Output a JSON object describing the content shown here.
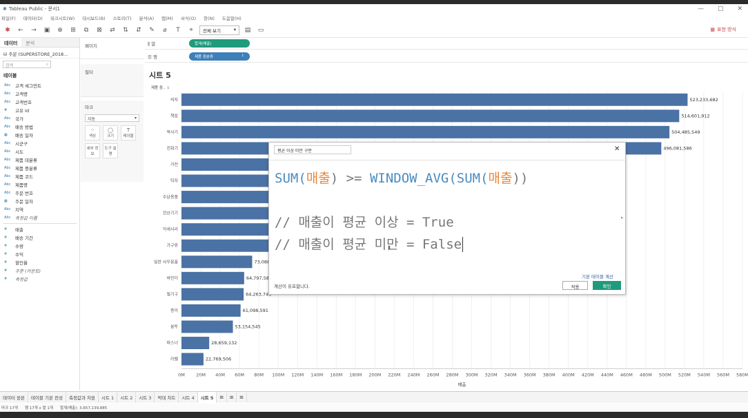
{
  "window": {
    "title": "Tableau Public - 문서1",
    "controls": [
      "—",
      "▢",
      "✕"
    ]
  },
  "menu": [
    "파일(F)",
    "데이터(D)",
    "워크시트(W)",
    "대시보드(B)",
    "스토리(T)",
    "분석(A)",
    "맵(M)",
    "서식(O)",
    "창(N)",
    "도움말(H)"
  ],
  "toolbar": {
    "view_select": "전체 보기",
    "showme": "표현 방식"
  },
  "datapane": {
    "tab_data": "데이터",
    "tab_analysis": "분석",
    "source": "주문 (SUPERSTORE_2018...",
    "search_placeholder": "검색",
    "tables_header": "테이블",
    "dimensions": [
      {
        "type": "Abc",
        "name": "고객 세그먼트"
      },
      {
        "type": "Abc",
        "name": "고객명"
      },
      {
        "type": "Abc",
        "name": "고객번호"
      },
      {
        "type": "#",
        "name": "고유 Id"
      },
      {
        "type": "Abc",
        "name": "국가"
      },
      {
        "type": "Abc",
        "name": "배송 방법"
      },
      {
        "type": "▦",
        "name": "배송 일자"
      },
      {
        "type": "Abc",
        "name": "시군구"
      },
      {
        "type": "Abc",
        "name": "시도"
      },
      {
        "type": "Abc",
        "name": "제품 대분류"
      },
      {
        "type": "Abc",
        "name": "제품 중분류"
      },
      {
        "type": "Abc",
        "name": "제품 코드"
      },
      {
        "type": "Abc",
        "name": "제품명"
      },
      {
        "type": "Abc",
        "name": "주문 번호"
      },
      {
        "type": "▦",
        "name": "주문 일자"
      },
      {
        "type": "Abc",
        "name": "지역"
      },
      {
        "type": "Abc",
        "name": "측정값 이름"
      }
    ],
    "measures": [
      {
        "type": "#",
        "name": "매출"
      },
      {
        "type": "#",
        "name": "배송 기간"
      },
      {
        "type": "#",
        "name": "수량"
      },
      {
        "type": "#",
        "name": "수익"
      },
      {
        "type": "#",
        "name": "할인율"
      },
      {
        "type": "#",
        "name": "주문 (카운트)"
      },
      {
        "type": "#",
        "name": "측정값"
      }
    ]
  },
  "shelves": {
    "pages": "페이지",
    "filters": "필터",
    "marks": "마크",
    "mark_type": "자동",
    "columns_label": "열",
    "rows_label": "행",
    "columns_pill": "합계(매출)",
    "rows_pill": "제품 중분류"
  },
  "mark_buttons": [
    {
      "icon": "⁘",
      "label": "색상"
    },
    {
      "icon": "◯",
      "label": "크기"
    },
    {
      "icon": "T",
      "label": "레이블"
    },
    {
      "icon": "",
      "label": "세부 정보"
    },
    {
      "icon": "",
      "label": "도구 설명"
    }
  ],
  "sheet": {
    "title": "시트 5",
    "row_header": "제품 중..",
    "x_axis_title": "매출"
  },
  "chart_data": {
    "type": "bar",
    "orientation": "horizontal",
    "categories": [
      "의자",
      "책장",
      "복사기",
      "전화기",
      "가전",
      "탁자",
      "수납용품",
      "전산기기",
      "악세사리",
      "가구류",
      "일반 사무용품",
      "바인더",
      "필기구",
      "종이",
      "봉투",
      "파스너",
      "라벨"
    ],
    "values": [
      523233682,
      514601912,
      504485549,
      496081586,
      null,
      null,
      null,
      null,
      null,
      null,
      73088000,
      64797580,
      64263743,
      61098591,
      53154545,
      28659132,
      22769506
    ],
    "data_labels": [
      "523,233,682",
      "514,601,912",
      "504,485,549",
      "496,081,586",
      "",
      "",
      "",
      "",
      "",
      "",
      "73,088,",
      "64,797,580",
      "64,263,743",
      "61,098,591",
      "53,154,545",
      "28,659,132",
      "22,769,506"
    ],
    "xlim": [
      0,
      580000000
    ],
    "x_ticks": [
      "0M",
      "20M",
      "40M",
      "60M",
      "80M",
      "100M",
      "120M",
      "140M",
      "160M",
      "180M",
      "200M",
      "220M",
      "240M",
      "260M",
      "280M",
      "300M",
      "320M",
      "340M",
      "360M",
      "380M",
      "400M",
      "420M",
      "440M",
      "460M",
      "480M",
      "500M",
      "520M",
      "540M",
      "560M",
      "580M"
    ],
    "color": "#4a72a5"
  },
  "dialog": {
    "name": "평균 이상 미만 구분",
    "code_line1": [
      {
        "t": "SUM(",
        "c": "fn"
      },
      {
        "t": "매출",
        "c": "fd"
      },
      {
        "t": ") >= ",
        "c": ""
      },
      {
        "t": "WINDOW_AVG(SUM(",
        "c": "fn"
      },
      {
        "t": "매출",
        "c": "fd"
      },
      {
        "t": "))",
        "c": ""
      }
    ],
    "code_line2": "// 매출이 평균 이상 = True",
    "code_line3": "// 매출이 평균 미만 = False",
    "basic_table_link": "기본 테이블 계산",
    "valid_message": "계산이 유효합니다.",
    "apply": "적용",
    "ok": "확인"
  },
  "tabs": [
    "데이터 원본",
    "테이블 기본 전성",
    "측정값과 차원",
    "시트 1",
    "시트 2",
    "시트 3",
    "막대 차트",
    "시트 4",
    "시트 5"
  ],
  "status": [
    "마크 17개",
    "행 17개 x 열 1개",
    "합계(매출): 3,657,139,885"
  ]
}
